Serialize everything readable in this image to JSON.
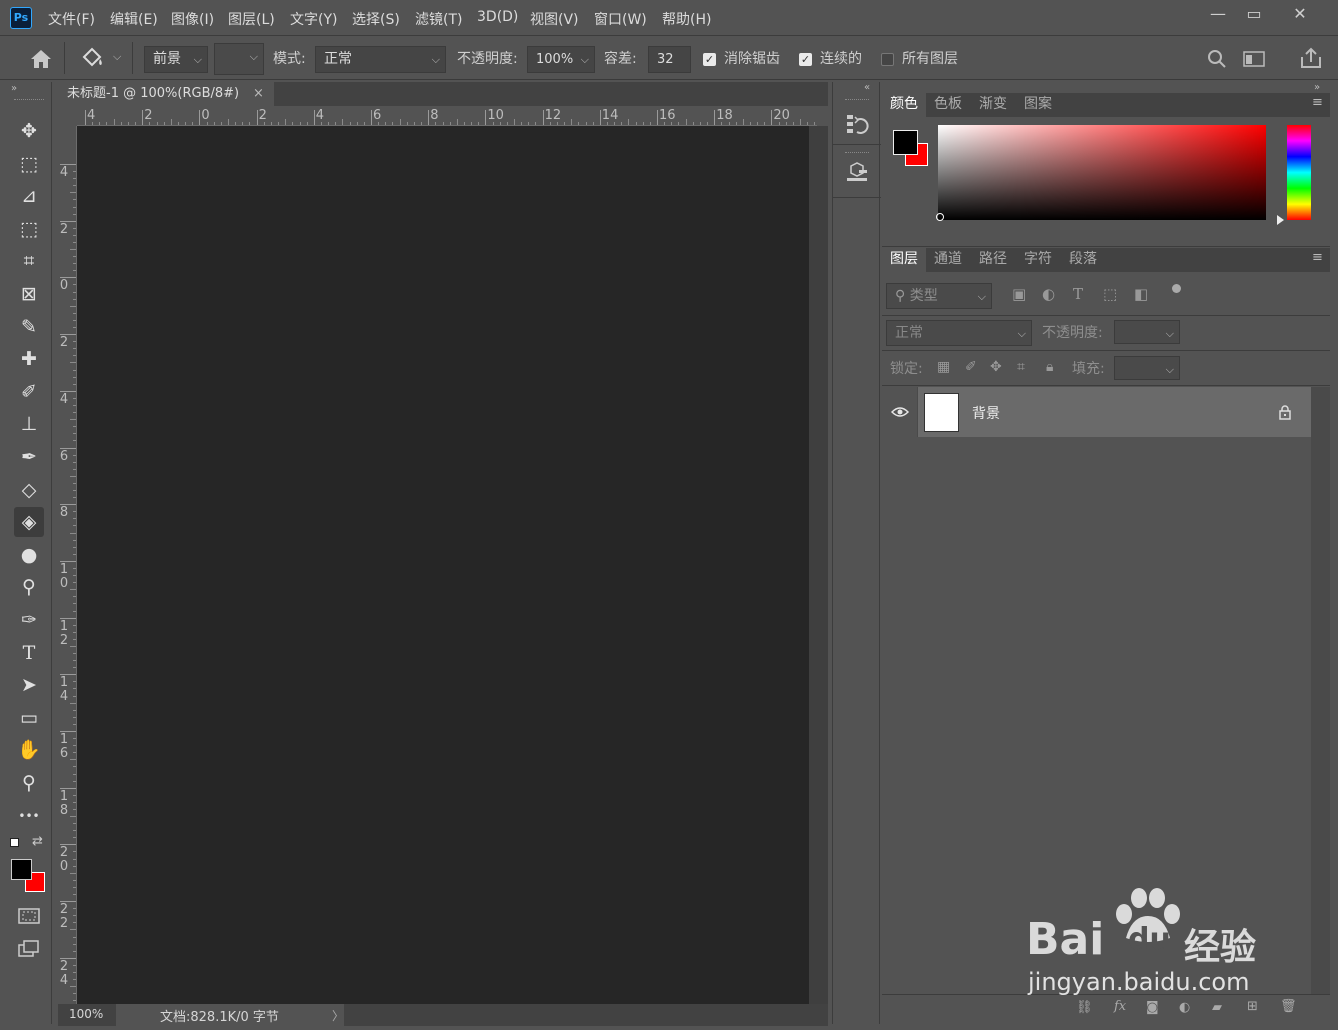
{
  "app": {
    "logo": "Ps"
  },
  "menu": [
    "文件(F)",
    "编辑(E)",
    "图像(I)",
    "图层(L)",
    "文字(Y)",
    "选择(S)",
    "滤镜(T)",
    "3D(D)",
    "视图(V)",
    "窗口(W)",
    "帮助(H)"
  ],
  "window_controls": {
    "minimize": "—",
    "restore": "▭",
    "close": "✕"
  },
  "options": {
    "fill_source": "前景",
    "mode_label": "模式:",
    "mode_value": "正常",
    "opacity_label": "不透明度:",
    "opacity_value": "100%",
    "tolerance_label": "容差:",
    "tolerance_value": "32",
    "antialias_label": "消除锯齿",
    "antialias_checked": true,
    "contiguous_label": "连续的",
    "contiguous_checked": true,
    "all_layers_label": "所有图层",
    "all_layers_checked": false
  },
  "document": {
    "tab_title": "未标题-1 @ 100%(RGB/8#)",
    "close": "×",
    "zoom": "100%",
    "doc_info": "文档:828.1K/0 字节",
    "status_arrow": "〉"
  },
  "rulers": {
    "horizontal": [
      "4",
      "2",
      "0",
      "2",
      "4",
      "6",
      "8",
      "10",
      "12",
      "14",
      "16",
      "18",
      "20"
    ],
    "vertical": [
      "4",
      "2",
      "0",
      "2",
      "4",
      "6",
      "8",
      "1 0",
      "1 2",
      "1 4",
      "1 6",
      "1 8",
      "2 0",
      "2 2",
      "2 4"
    ]
  },
  "tools": [
    {
      "name": "move-tool-icon",
      "glyph": "✥"
    },
    {
      "name": "marquee-tool-icon",
      "glyph": "⬚"
    },
    {
      "name": "lasso-tool-icon",
      "glyph": "⊿"
    },
    {
      "name": "object-select-tool-icon",
      "glyph": "⬚"
    },
    {
      "name": "crop-tool-icon",
      "glyph": "⌗"
    },
    {
      "name": "frame-tool-icon",
      "glyph": "⊠"
    },
    {
      "name": "eyedropper-tool-icon",
      "glyph": "✎"
    },
    {
      "name": "healing-brush-tool-icon",
      "glyph": "✚"
    },
    {
      "name": "brush-tool-icon",
      "glyph": "✐"
    },
    {
      "name": "clone-stamp-tool-icon",
      "glyph": "⊥"
    },
    {
      "name": "history-brush-tool-icon",
      "glyph": "✒"
    },
    {
      "name": "eraser-tool-icon",
      "glyph": "◇"
    },
    {
      "name": "paint-bucket-tool-icon",
      "glyph": "◈"
    },
    {
      "name": "blur-tool-icon",
      "glyph": "●"
    },
    {
      "name": "dodge-tool-icon",
      "glyph": "⚲"
    },
    {
      "name": "pen-tool-icon",
      "glyph": "✑"
    },
    {
      "name": "type-tool-icon",
      "glyph": "T"
    },
    {
      "name": "path-select-tool-icon",
      "glyph": "➤"
    },
    {
      "name": "rectangle-tool-icon",
      "glyph": "▭"
    },
    {
      "name": "hand-tool-icon",
      "glyph": "✋"
    },
    {
      "name": "zoom-tool-icon",
      "glyph": "⚲"
    },
    {
      "name": "more-tools-icon",
      "glyph": "•••"
    }
  ],
  "colors": {
    "foreground": "#000000",
    "background": "#ff0000"
  },
  "color_panel": {
    "tabs": [
      "颜色",
      "色板",
      "渐变",
      "图案"
    ]
  },
  "layers_panel": {
    "tabs": [
      "图层",
      "通道",
      "路径",
      "字符",
      "段落"
    ],
    "filter_placeholder": "类型",
    "blend_mode": "正常",
    "opacity_label": "不透明度:",
    "lock_label": "锁定:",
    "fill_label": "填充:",
    "layers": [
      {
        "name": "背景",
        "visible": true,
        "locked": true
      }
    ]
  },
  "watermark": {
    "brand": "Bai",
    "brand2": "du",
    "cn": "经验",
    "url": "jingyan.baidu.com"
  }
}
